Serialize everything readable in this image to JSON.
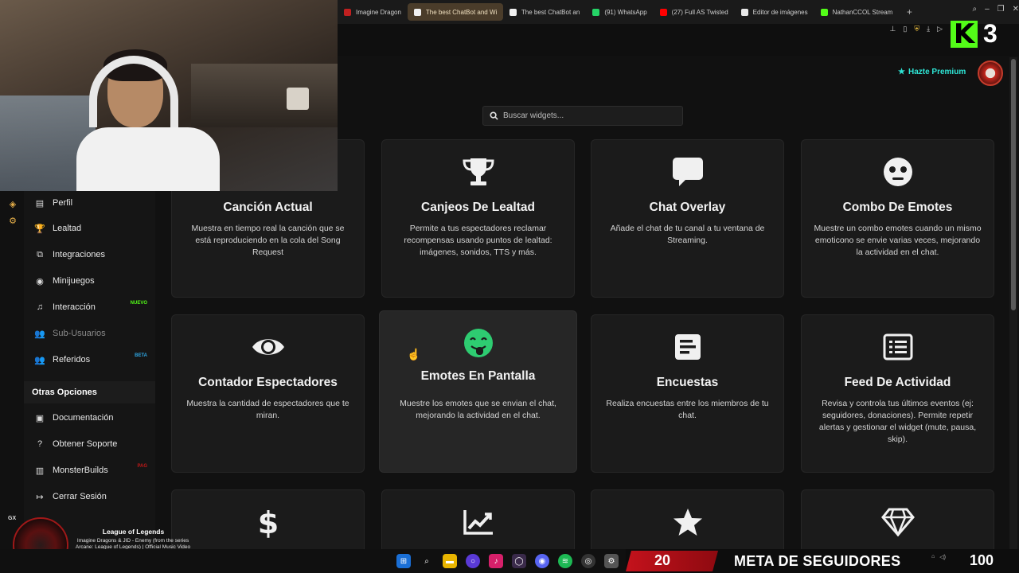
{
  "browser": {
    "tabs": [
      {
        "label": "Imagine Dragon",
        "color": "#c02020",
        "active": false
      },
      {
        "label": "The best ChatBot and Wi",
        "color": "#f0f0f0",
        "active": true
      },
      {
        "label": "The best ChatBot an",
        "color": "#f0f0f0",
        "active": false
      },
      {
        "label": "(91) WhatsApp",
        "color": "#25d366",
        "active": false
      },
      {
        "label": "(27) Full AS Twisted",
        "color": "#ff0000",
        "active": false
      },
      {
        "label": "Editor de imágenes",
        "color": "#e8e8e8",
        "active": false
      },
      {
        "label": "NathanCCOL Stream",
        "color": "#53fc18",
        "active": false
      }
    ],
    "new_tab": "+"
  },
  "overlay": {
    "kick_logo": "K",
    "kick_viewers": "3"
  },
  "header": {
    "premium_label": "Hazte Premium",
    "search_placeholder": "Buscar widgets..."
  },
  "sidebar": {
    "items": [
      {
        "label": "Perfil",
        "icon": "id-card-icon",
        "glyph": "▤",
        "top": 0
      },
      {
        "label": "Lealtad",
        "icon": "trophy-icon",
        "glyph": "🏆"
      },
      {
        "label": "Integraciones",
        "icon": "puzzle-icon",
        "glyph": "⧉"
      },
      {
        "label": "Minijuegos",
        "icon": "gamepad-icon",
        "glyph": "◉"
      },
      {
        "label": "Interacción",
        "icon": "music-icon",
        "glyph": "♫",
        "badge": "NUEVO",
        "badge_color": "#53fc18"
      },
      {
        "label": "Sub-Usuarios",
        "icon": "users-icon",
        "glyph": "👥",
        "muted": true
      },
      {
        "label": "Referidos",
        "icon": "user-group-icon",
        "glyph": "👥",
        "badge": "BETA",
        "badge_color": "#2ea8e6"
      }
    ],
    "section_title": "Otras Opciones",
    "other_items": [
      {
        "label": "Documentación",
        "icon": "book-icon",
        "glyph": "▣"
      },
      {
        "label": "Obtener Soporte",
        "icon": "help-icon",
        "glyph": "?"
      },
      {
        "label": "MonsterBuilds",
        "icon": "monster-icon",
        "glyph": "▥",
        "badge": "PAG",
        "badge_color": "#c01818"
      },
      {
        "label": "Cerrar Sesión",
        "icon": "logout-icon",
        "glyph": "↦"
      }
    ]
  },
  "widgets": [
    {
      "title": "Canción Actual",
      "desc": "Muestra en tiempo real la canción que se está reproduciendo en la cola del Song Request",
      "icon": "music-icon"
    },
    {
      "title": "Canjeos De Lealtad",
      "desc": "Permite a tus espectadores reclamar recompensas usando puntos de lealtad: imágenes, sonidos, TTS y más.",
      "icon": "trophy-icon"
    },
    {
      "title": "Chat Overlay",
      "desc": "Añade el chat de tu canal a tu ventana de Streaming.",
      "icon": "chat-bubble-icon"
    },
    {
      "title": "Combo De Emotes",
      "desc": "Muestre un combo emotes cuando un mismo emoticono se envie varias veces, mejorando la actividad en el chat.",
      "icon": "emoji-face-icon"
    },
    {
      "title": "Contador Espectadores",
      "desc": "Muestra la cantidad de espectadores que te miran.",
      "icon": "eye-icon"
    },
    {
      "title": "Emotes En Pantalla",
      "desc": "Muestre los emotes que se envian el chat, mejorando la actividad en el chat.",
      "icon": "tongue-emoji-icon"
    },
    {
      "title": "Encuestas",
      "desc": "Realiza encuestas entre los miembros de tu chat.",
      "icon": "poll-icon"
    },
    {
      "title": "Feed De Actividad",
      "desc": "Revisa y controla tus últimos eventos (ej: seguidores, donaciones). Permite repetir alertas y gestionar el widget (mute, pausa, skip).",
      "icon": "list-icon"
    },
    {
      "title": "",
      "desc": "",
      "icon": "dollar-icon"
    },
    {
      "title": "",
      "desc": "",
      "icon": "chart-line-icon"
    },
    {
      "title": "",
      "desc": "",
      "icon": "star-icon"
    },
    {
      "title": "",
      "desc": "",
      "icon": "diamond-icon"
    }
  ],
  "music_player": {
    "badge": "GX",
    "title": "League of Legends",
    "subtitle": "Imagine Dragons & JID - Enemy (from the series Arcane: League of Legends) | Official Music Video"
  },
  "follower_goal": {
    "current": "20",
    "label": "META DE SEGUIDORES",
    "target": "100"
  },
  "colors": {
    "accent_teal": "#2ee6d6",
    "kick_green": "#53fc18",
    "goal_red": "#c4121c",
    "emote_green": "#2ecc71"
  }
}
